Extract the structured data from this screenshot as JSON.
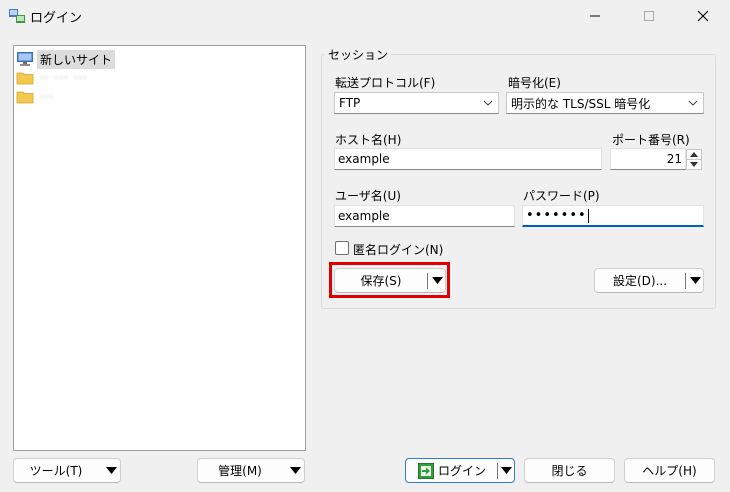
{
  "window": {
    "title": "ログイン",
    "icons": {
      "app": "winscp-app-icon",
      "minimize": "minimize-icon",
      "maximize": "maximize-icon",
      "close": "close-icon"
    }
  },
  "sites": {
    "items": [
      {
        "label": "新しいサイト",
        "icon": "computer-icon",
        "selected": true
      },
      {
        "label": "·· ··· ···",
        "icon": "folder-icon",
        "blurred": true
      },
      {
        "label": "···",
        "icon": "folder-icon",
        "blurred": true
      }
    ]
  },
  "session": {
    "legend": "セッション",
    "protocol_label": "転送プロトコル(F)",
    "protocol_value": "FTP",
    "encryption_label": "暗号化(E)",
    "encryption_value": "明示的な TLS/SSL 暗号化",
    "host_label": "ホスト名(H)",
    "host_value": "example",
    "port_label": "ポート番号(R)",
    "port_value": "21",
    "user_label": "ユーザ名(U)",
    "user_value": "example",
    "password_label": "パスワード(P)",
    "password_value": "•••••••",
    "anonymous_label": "匿名ログイン(N)",
    "anonymous_checked": false,
    "save_label": "保存(S)",
    "advanced_label": "設定(D)..."
  },
  "bottom": {
    "tools_label": "ツール(T)",
    "manage_label": "管理(M)",
    "login_label": "ログイン",
    "close_label": "閉じる",
    "help_label": "ヘルプ(H)"
  },
  "colors": {
    "highlight": "#e00000",
    "focus_accent": "#005fb8",
    "login_border": "#2d7dc9",
    "selected_bg": "#dcdcdc"
  }
}
